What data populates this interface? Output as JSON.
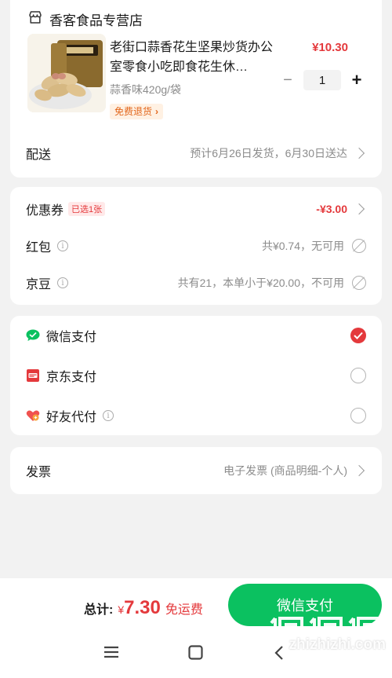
{
  "store": {
    "name": "香客食品专营店",
    "product": {
      "title": "老街口蒜香花生坚果炒货办公室零食小吃即食花生休…",
      "spec": "蒜香味420g/袋",
      "return_tag": "免费退货",
      "price": "¥10.30",
      "quantity": "1",
      "minus": "−",
      "plus": "+"
    },
    "delivery": {
      "label": "配送",
      "value": "预计6月26日发货，6月30日送达"
    }
  },
  "discounts": {
    "coupon": {
      "label": "优惠券",
      "badge": "已选1张",
      "amount": "-¥3.00"
    },
    "red_packet": {
      "label": "红包",
      "value": "共¥0.74，无可用"
    },
    "jd_beans": {
      "label": "京豆",
      "value": "共有21，本单小于¥20.00，不可用"
    }
  },
  "payment": {
    "options": [
      {
        "label": "微信支付",
        "icon": "wechat-pay-icon",
        "selected": true
      },
      {
        "label": "京东支付",
        "icon": "jd-pay-icon",
        "selected": false
      },
      {
        "label": "好友代付",
        "icon": "friend-pay-icon",
        "selected": false
      }
    ]
  },
  "invoice": {
    "label": "发票",
    "value": "电子发票 (商品明细-个人)"
  },
  "bottom": {
    "total_label": "总计:",
    "currency": "¥",
    "total": "7.30",
    "free_shipping": "免运费",
    "pay_button": "微信支付"
  },
  "watermark": {
    "text": "zhizhizhi.com"
  },
  "colors": {
    "accent_red": "#e4393c",
    "wechat_green": "#0bc160",
    "tag_orange": "#e2651a"
  }
}
